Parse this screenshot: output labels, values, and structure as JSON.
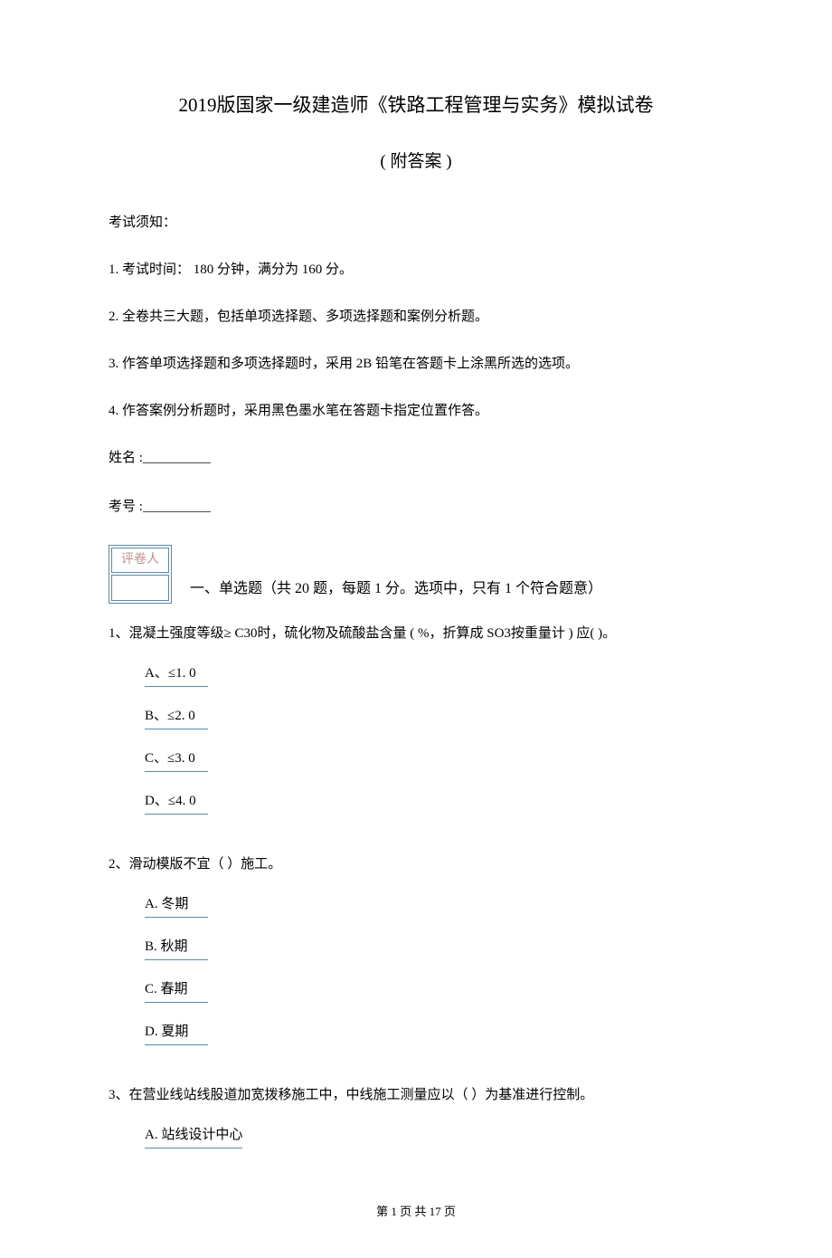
{
  "title": "2019版国家一级建造师《铁路工程管理与实务》模拟试卷",
  "subtitle": "( 附答案 )",
  "instructions": {
    "heading": "考试须知：",
    "items": [
      "1. 考试时间：  180 分钟，满分为  160 分。",
      "2. 全卷共三大题，包括单项选择题、多项选择题和案例分析题。",
      "3. 作答单项选择题和多项选择题时，采用    2B 铅笔在答题卡上涂黑所选的选项。",
      "4. 作答案例分析题时，采用黑色墨水笔在答题卡指定位置作答。"
    ]
  },
  "fields": {
    "name": "姓名 :__________",
    "exam_no": "考号 :__________"
  },
  "grader_label": "评卷人",
  "section1": {
    "heading": "一、单选题（共  20 题，每题  1 分。选项中，只有  1 个符合题意）"
  },
  "questions": [
    {
      "num": "1、",
      "text": "混凝土强度等级≥ C30时，硫化物及硫酸盐含量   ( %，折算成 SO3按重量计 ) 应(    )。",
      "options": [
        "A、≤1.  0",
        "B、≤2.  0",
        "C、≤3.  0",
        "D、≤4.  0"
      ]
    },
    {
      "num": "2、",
      "text": "滑动模版不宜（      ）施工。",
      "options": [
        "A.  冬期",
        "B.  秋期",
        "C.  春期",
        "D.  夏期"
      ]
    },
    {
      "num": "3、",
      "text": "在营业线站线股道加宽拨移施工中，中线施工测量应以（        ）为基准进行控制。",
      "options": [
        "A.  站线设计中心"
      ]
    }
  ],
  "footer": "第  1 页 共 17 页"
}
